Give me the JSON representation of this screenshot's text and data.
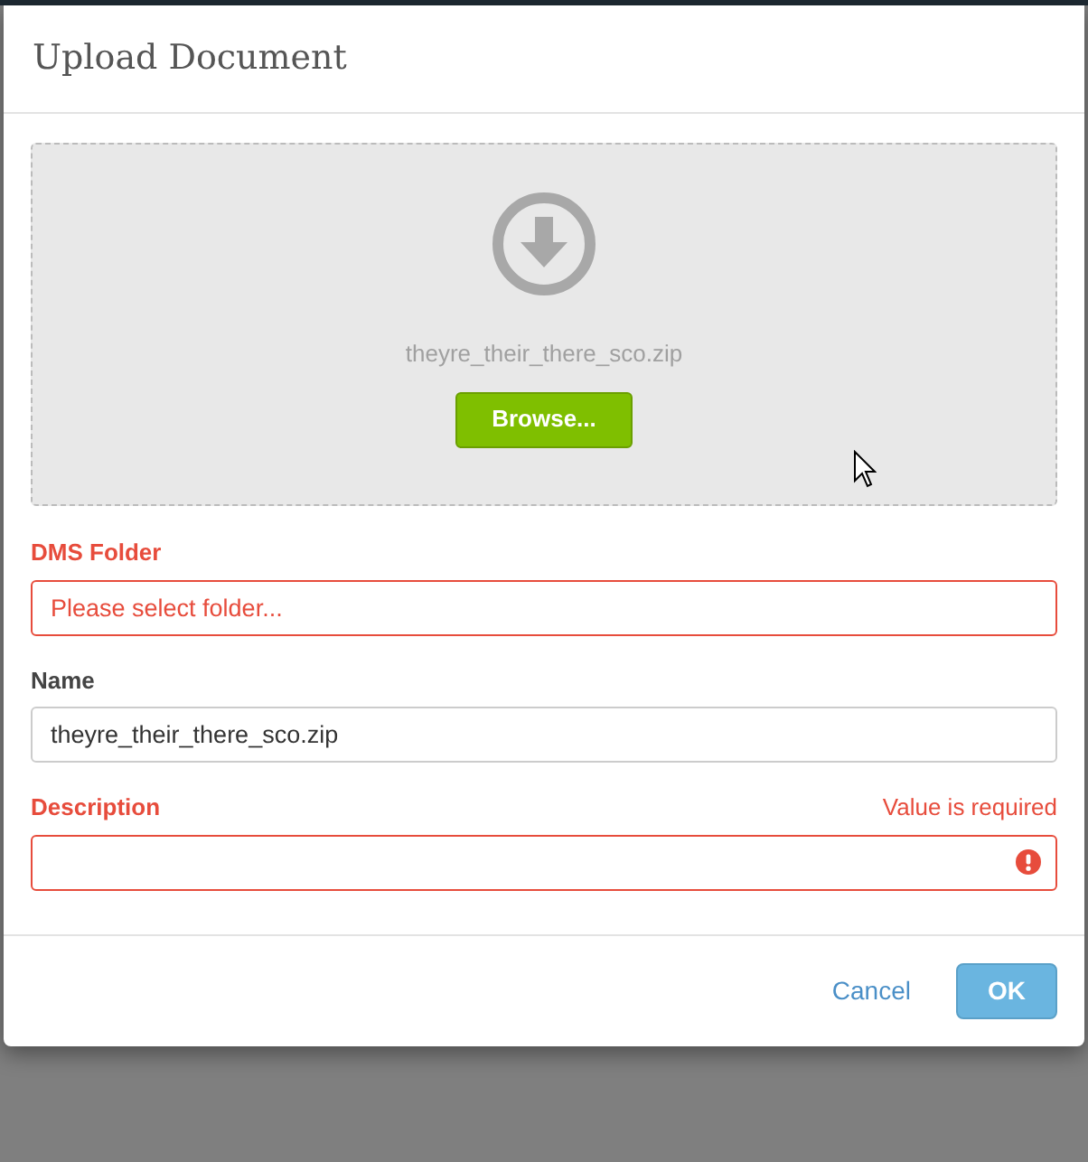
{
  "dialog": {
    "title": "Upload Document"
  },
  "dropzone": {
    "file_name": "theyre_their_there_sco.zip",
    "browse_button": "Browse..."
  },
  "fields": [
    {
      "label": "DMS Folder",
      "placeholder": "Please select folder...",
      "invalid": true
    },
    {
      "label": "Name",
      "value": "theyre_their_there_sco.zip",
      "invalid": false
    },
    {
      "label": "Description",
      "invalid": true,
      "error": "Value is required"
    }
  ],
  "buttons": [
    {
      "label": "Cancel",
      "kind": "link"
    },
    {
      "label": "OK",
      "kind": "primary"
    }
  ]
}
